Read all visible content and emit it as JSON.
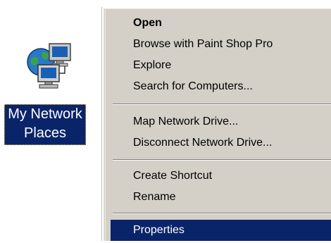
{
  "desktop_icon": {
    "label_line1": "My Network",
    "label_line2": "Places",
    "icon": "network-places-icon"
  },
  "context_menu": {
    "items": [
      {
        "label": "Open",
        "bold": true
      },
      {
        "label": "Browse with Paint Shop Pro"
      },
      {
        "label": "Explore"
      },
      {
        "label": "Search for Computers..."
      },
      {
        "label": "Map Network Drive..."
      },
      {
        "label": "Disconnect Network Drive..."
      },
      {
        "label": "Create Shortcut"
      },
      {
        "label": "Rename"
      },
      {
        "label": "Properties",
        "highlighted": true
      }
    ]
  },
  "colors": {
    "selection": "#0a246a",
    "menu_face": "#d4d0c8",
    "desktop": "#ffffff"
  }
}
